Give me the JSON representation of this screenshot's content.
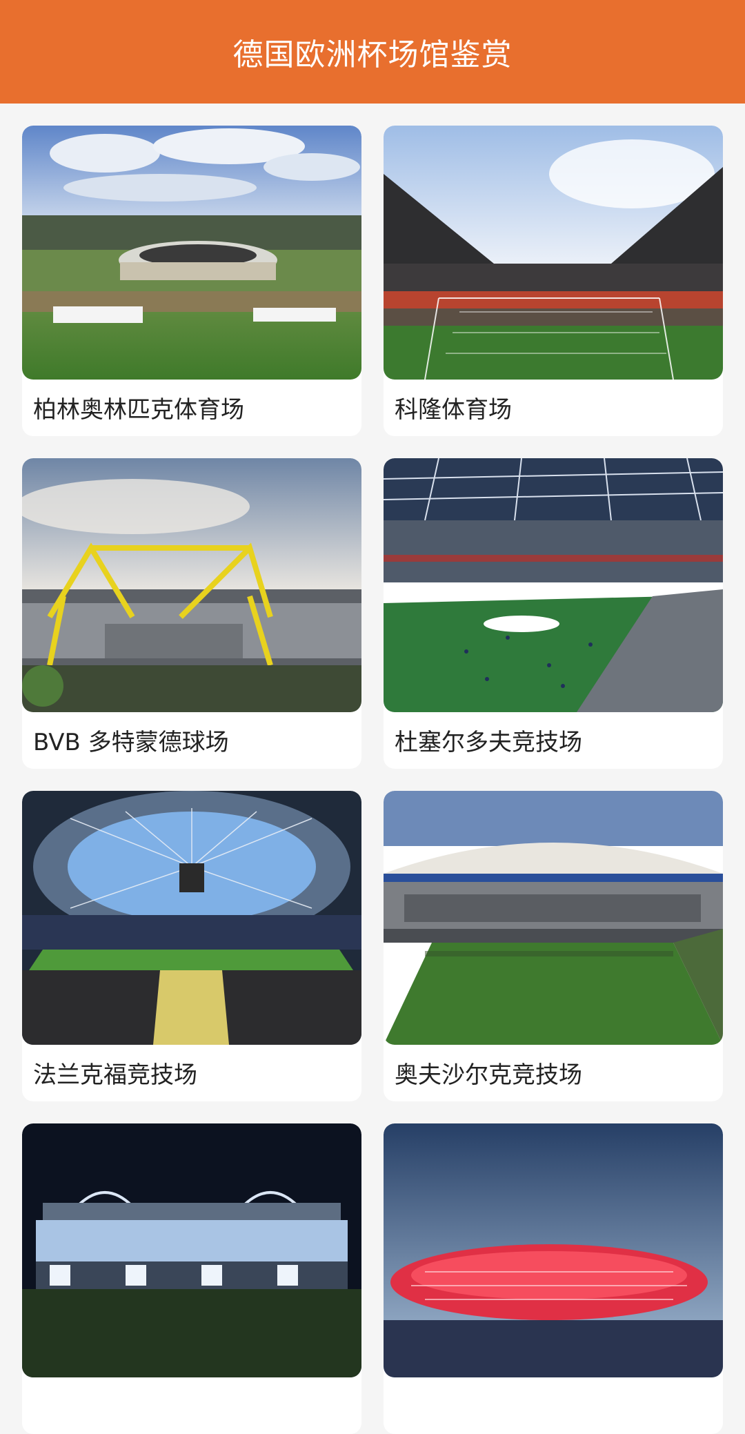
{
  "header": {
    "title": "德国欧洲杯场馆鉴赏",
    "background": "#E86F2E"
  },
  "cards": [
    {
      "title": "柏林奥林匹克体育场",
      "image": "stadium-photo-berlin"
    },
    {
      "title": "科隆体育场",
      "image": "stadium-photo-cologne"
    },
    {
      "title": "BVB 多特蒙德球场",
      "image": "stadium-photo-dortmund"
    },
    {
      "title": "杜塞尔多夫竞技场",
      "image": "stadium-photo-dusseldorf"
    },
    {
      "title": "法兰克福竞技场",
      "image": "stadium-photo-frankfurt"
    },
    {
      "title": "奥夫沙尔克竞技场",
      "image": "stadium-photo-gelsenkirchen"
    },
    {
      "title": "",
      "image": "stadium-photo-leipzig"
    },
    {
      "title": "",
      "image": "stadium-photo-munich"
    }
  ]
}
